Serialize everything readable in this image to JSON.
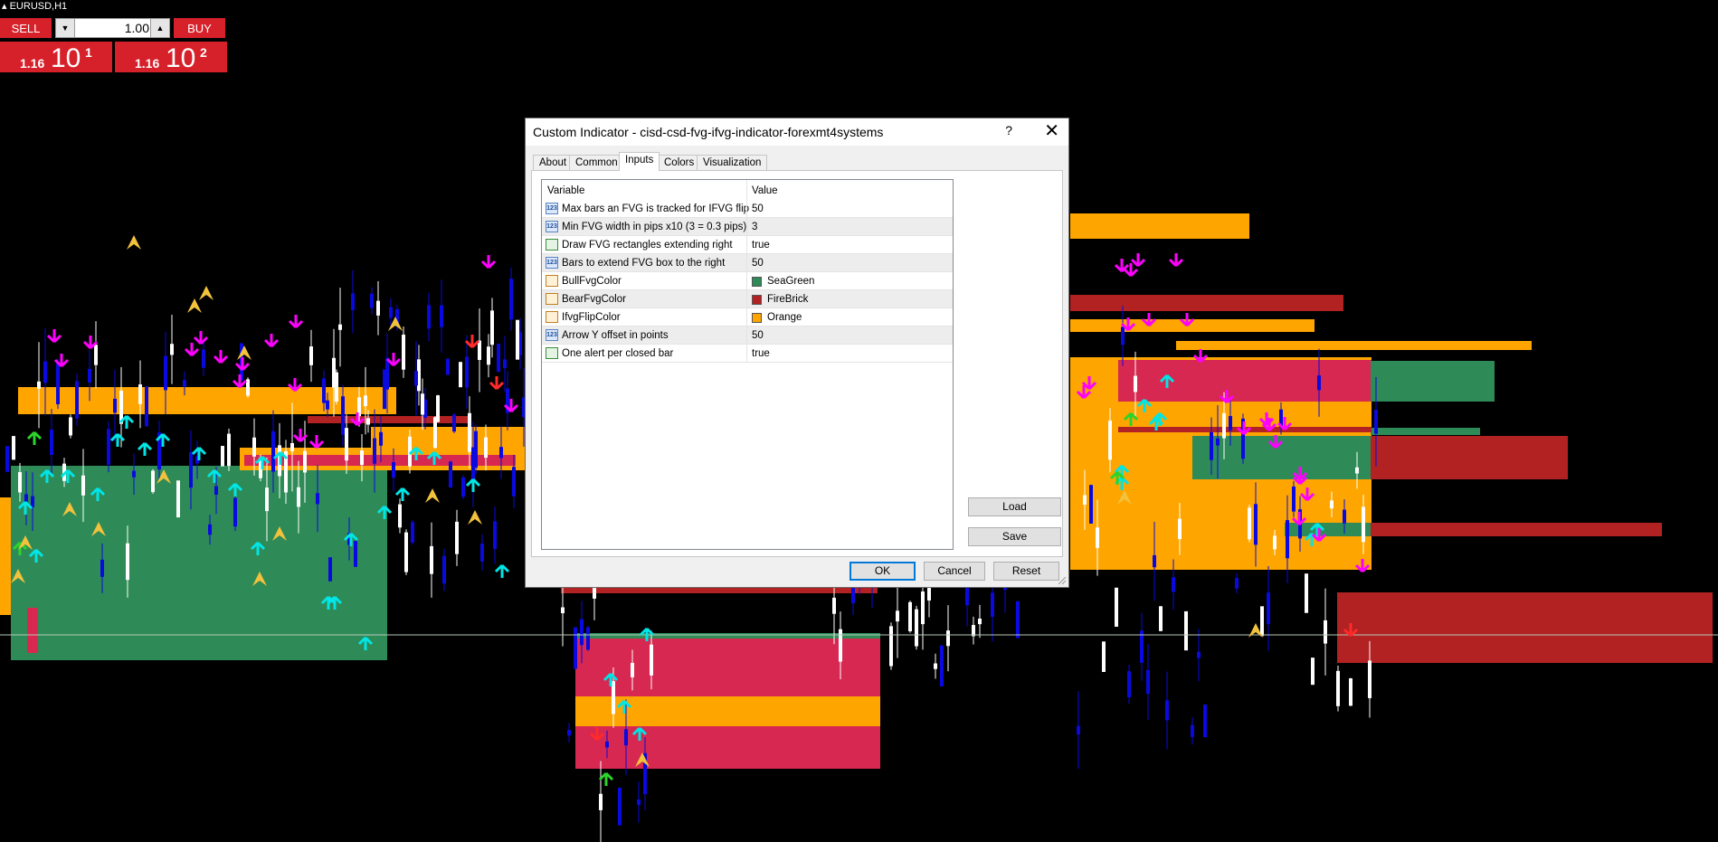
{
  "symbol": "EURUSD,H1",
  "trade_panel": {
    "sell_label": "SELL",
    "buy_label": "BUY",
    "lot_value": "1.00",
    "sell_price_small": "1.16",
    "sell_price_big": "10",
    "sell_price_sup": "1",
    "buy_price_small": "1.16",
    "buy_price_big": "10",
    "buy_price_sup": "2"
  },
  "dialog": {
    "title": "Custom Indicator - cisd-csd-fvg-ifvg-indicator-forexmt4systems",
    "help": "?",
    "close": "✕",
    "tabs": [
      "About",
      "Common",
      "Inputs",
      "Colors",
      "Visualization"
    ],
    "active_tab": "Inputs",
    "columns": {
      "variable": "Variable",
      "value": "Value"
    },
    "rows": [
      {
        "name": "Max bars an FVG is tracked for IFVG flip",
        "value": "50",
        "type": "int"
      },
      {
        "name": "Min FVG width in pips x10 (3 = 0.3 pips)",
        "value": "3",
        "type": "int"
      },
      {
        "name": "Draw FVG rectangles extending right",
        "value": "true",
        "type": "bool"
      },
      {
        "name": "Bars to extend FVG box to the right",
        "value": "50",
        "type": "int"
      },
      {
        "name": "BullFvgColor",
        "value": "SeaGreen",
        "type": "color",
        "color": "#2e8b57"
      },
      {
        "name": "BearFvgColor",
        "value": "FireBrick",
        "type": "color",
        "color": "#b22222"
      },
      {
        "name": "IfvgFlipColor",
        "value": "Orange",
        "type": "color",
        "color": "#ffa500"
      },
      {
        "name": "Arrow Y offset in points",
        "value": "50",
        "type": "int"
      },
      {
        "name": "One alert per closed bar",
        "value": "true",
        "type": "bool"
      }
    ],
    "load_label": "Load",
    "save_label": "Save",
    "ok_label": "OK",
    "cancel_label": "Cancel",
    "reset_label": "Reset"
  },
  "colors": {
    "background": "#000000",
    "bull": "#2e8b57",
    "bear": "#b22222",
    "flip": "#ffa500",
    "bear_light": "#d62850",
    "bull_candle": "#ffffff",
    "bear_candle": "#0a0ae0",
    "arrow_up": "#00e5e5",
    "arrow_down": "#ff00ff",
    "sell_button": "#d6202a"
  }
}
